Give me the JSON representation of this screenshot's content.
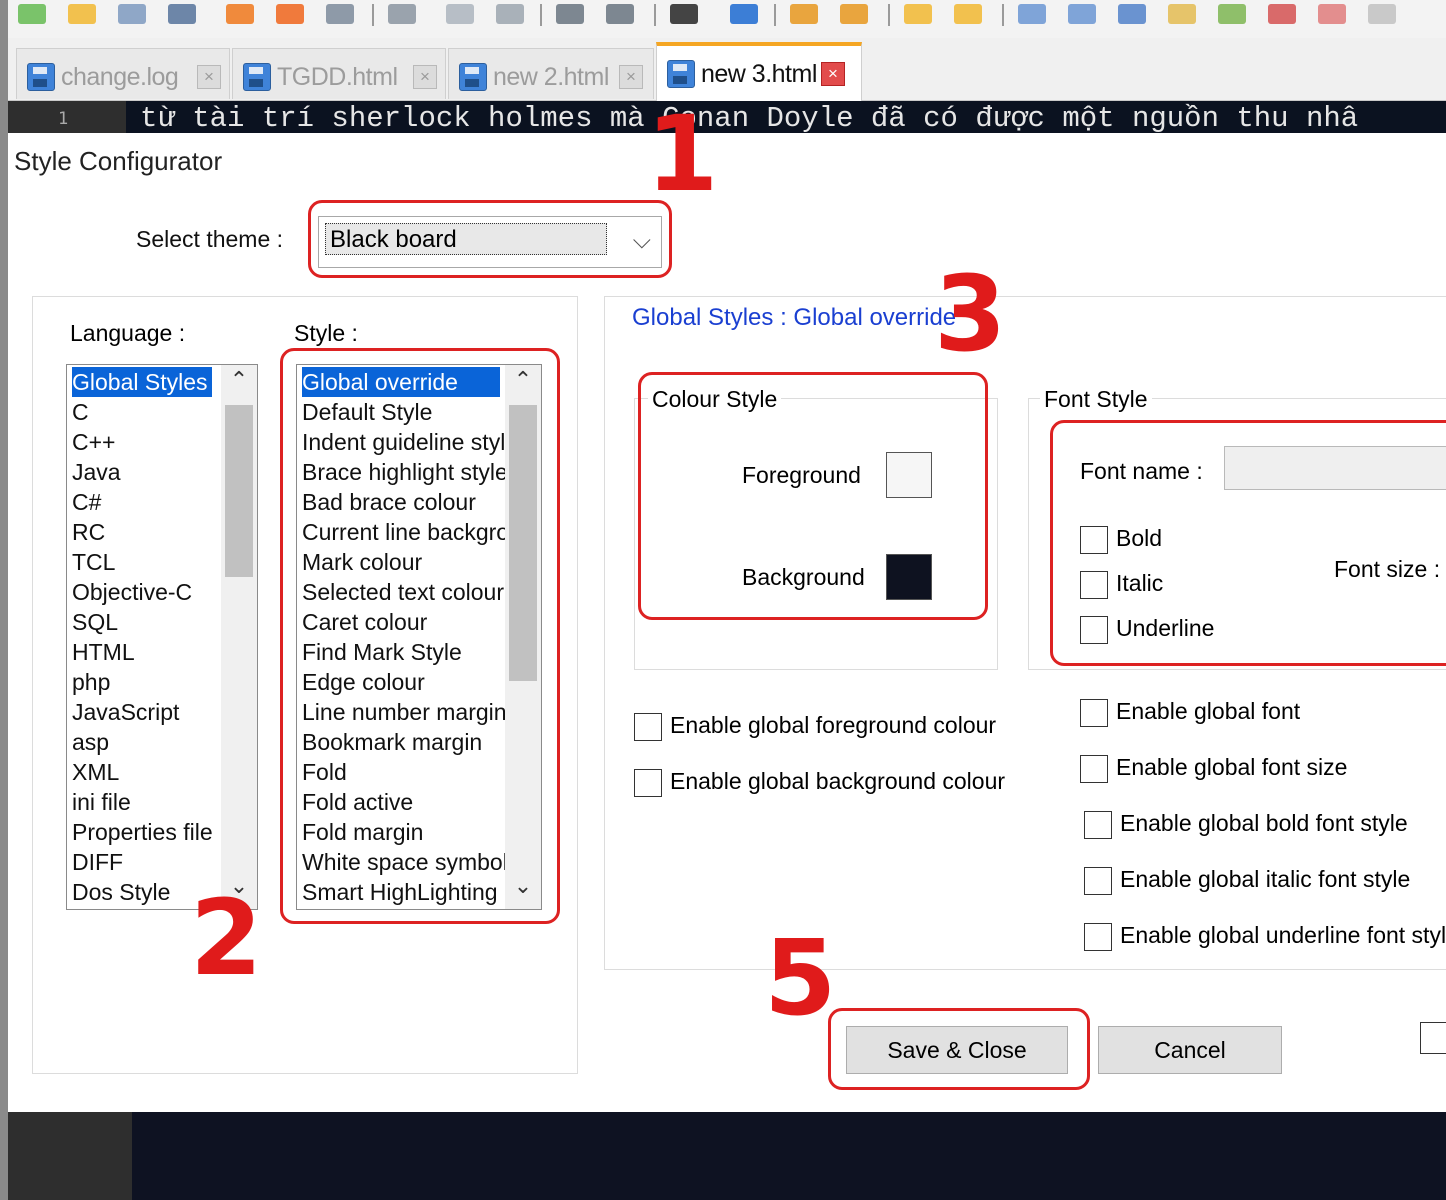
{
  "tabs": [
    {
      "label": "change.log",
      "active": false
    },
    {
      "label": "TGDD.html",
      "active": false
    },
    {
      "label": "new 2.html",
      "active": false
    },
    {
      "label": "new 3.html",
      "active": true
    }
  ],
  "editor": {
    "line_number": "1",
    "line_text": "từ tài trí sherlock holmes mà Conan Doyle đã có được một nguồn thu nhâ"
  },
  "dialog": {
    "title": "Style Configurator",
    "theme_label": "Select theme :",
    "theme_value": "Black board",
    "language_label": "Language :",
    "style_label": "Style :",
    "languages": [
      "Global Styles",
      "C",
      "C++",
      "Java",
      "C#",
      "RC",
      "TCL",
      "Objective-C",
      "SQL",
      "HTML",
      "php",
      "JavaScript",
      "asp",
      "XML",
      "ini file",
      "Properties file",
      "DIFF",
      "Dos Style"
    ],
    "selected_language": "Global Styles",
    "styles": [
      "Global override",
      "Default Style",
      "Indent guideline style",
      "Brace highlight style",
      "Bad brace colour",
      "Current line background colour",
      "Mark colour",
      "Selected text colour",
      "Caret colour",
      "Find Mark Style",
      "Edge colour",
      "Line number margin",
      "Bookmark margin",
      "Fold",
      "Fold active",
      "Fold margin",
      "White space symbol",
      "Smart HighLighting"
    ],
    "selected_style": "Global override",
    "heading": "Global Styles : Global override",
    "colour_style": {
      "title": "Colour Style",
      "foreground_label": "Foreground",
      "background_label": "Background",
      "foreground_color": "#f6f6f6",
      "background_color": "#0e1220"
    },
    "font_style": {
      "title": "Font Style",
      "font_name_label": "Font name :",
      "font_size_label": "Font size :",
      "bold_label": "Bold",
      "italic_label": "Italic",
      "underline_label": "Underline"
    },
    "global_colour_options": [
      "Enable global foreground colour",
      "Enable global background colour"
    ],
    "global_font_options": [
      "Enable global font",
      "Enable global font size",
      "Enable global bold font style",
      "Enable global italic font style",
      "Enable global underline font style"
    ],
    "save_button": "Save & Close",
    "cancel_button": "Cancel"
  },
  "annotations": [
    "1",
    "2",
    "3",
    "5"
  ],
  "accent_colors": {
    "annotation_red": "#dd2222",
    "selection_blue": "#0a64d8",
    "heading_blue": "#1a3fd1"
  }
}
